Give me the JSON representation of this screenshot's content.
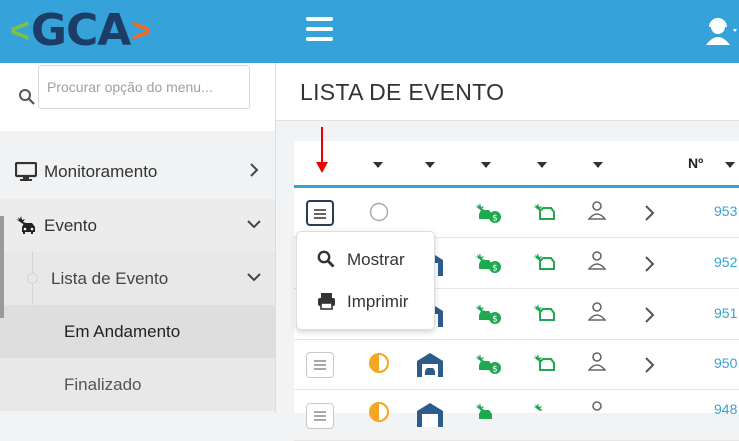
{
  "brand": {
    "logo_text": "GCA",
    "left_chevron": "<",
    "right_chevron": ">"
  },
  "topbar": {
    "menu_icon": "hamburger-icon",
    "user_icon": "user-headset-icon"
  },
  "sidebar": {
    "search_placeholder": "Procurar opção do menu...",
    "items": [
      {
        "label": "Monitoramento",
        "icon": "monitor-icon"
      },
      {
        "label": "Evento",
        "icon": "car-crash-icon"
      },
      {
        "label": "Lista de Evento"
      },
      {
        "label": "Em Andamento"
      },
      {
        "label": "Finalizado"
      }
    ]
  },
  "page": {
    "title": "LISTA DE EVENTO"
  },
  "table": {
    "number_header": "Nº",
    "rows": [
      {
        "number": "953"
      },
      {
        "number": "952"
      },
      {
        "number": "951"
      },
      {
        "number": "950"
      },
      {
        "number": "948"
      }
    ]
  },
  "dropdown": {
    "items": [
      {
        "label": "Mostrar",
        "icon": "search-icon"
      },
      {
        "label": "Imprimir",
        "icon": "print-icon"
      }
    ]
  },
  "colors": {
    "accent": "#35a3d9",
    "green": "#1ea84f",
    "orange": "#f5a623",
    "navy": "#2d5c8c",
    "arrow": "#e00000"
  }
}
